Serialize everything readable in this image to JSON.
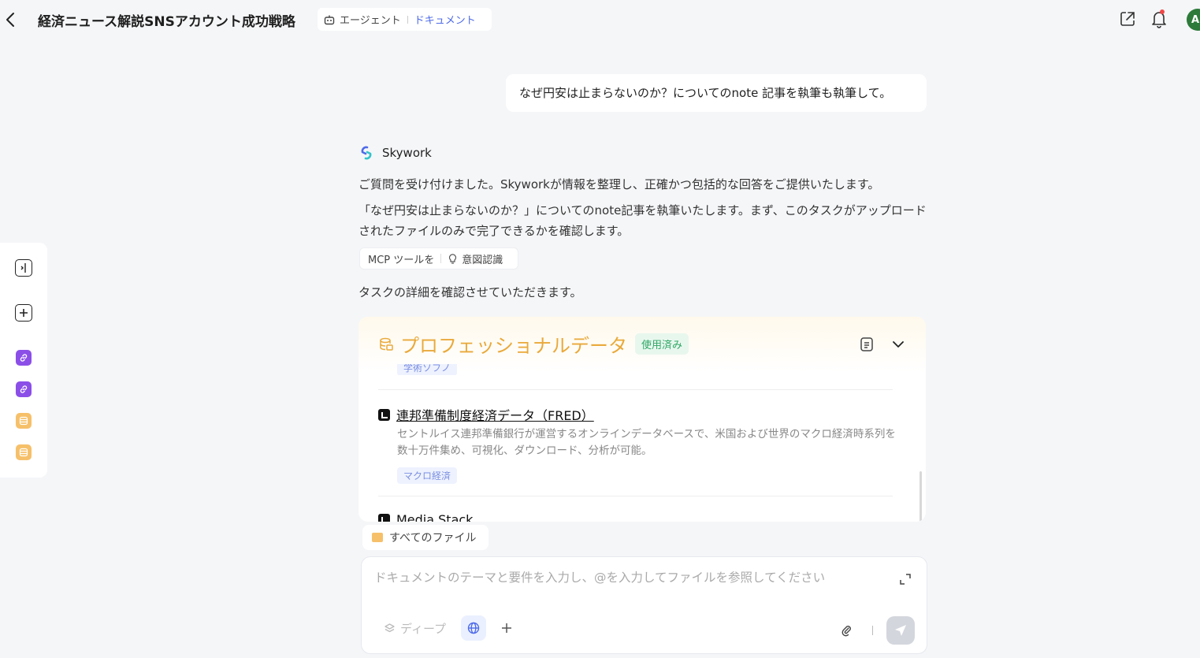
{
  "header": {
    "title": "経済ニュース解説SNSアカウント成功戦略",
    "mode_agent": "エージェント",
    "mode_document": "ドキュメント",
    "avatar_letter": "A"
  },
  "chat": {
    "user_message": "なぜ円安は止まらないのか？についてのnote 記事を執筆も執筆して。",
    "bot_name": "Skywork",
    "bot_para1": "ご質問を受け付けました。Skyworkが情報を整理し、正確かつ包括的な回答をご提供いたします。",
    "bot_para2": "「なぜ円安は止まらないのか？」についてのnote記事を執筆いたします。まず、このタスクがアップロードされたファイルのみで完了できるかを確認します。",
    "chip_mcp": "MCP ツールを",
    "chip_intent": "意図認識",
    "bot_para3": "タスクの詳細を確認させていただきます。"
  },
  "pro_card": {
    "title": "プロフェッショナルデータ",
    "used_badge": "使用済み",
    "cut_tag": "学術ソフノ",
    "sources": [
      {
        "name": "連邦準備制度経済データ（FRED）",
        "description": "セントルイス連邦準備銀行が運営するオンラインデータベースで、米国および世界のマクロ経済時系列を数十万件集め、可視化、ダウンロード、分析が可能。",
        "tag": "マクロ経済"
      },
      {
        "name": "Media Stack"
      }
    ]
  },
  "composer": {
    "all_files": "すべてのファイル",
    "placeholder": "ドキュメントのテーマと要件を入力し、@を入力してファイルを参照してください",
    "deep_label": "ディープ"
  },
  "colors": {
    "accent_blue": "#4f6be8",
    "pro_orange": "#e9a93a",
    "used_green": "#2fa866",
    "tool_purple": "#8b4fe8",
    "tool_orange": "#f6c06a"
  }
}
